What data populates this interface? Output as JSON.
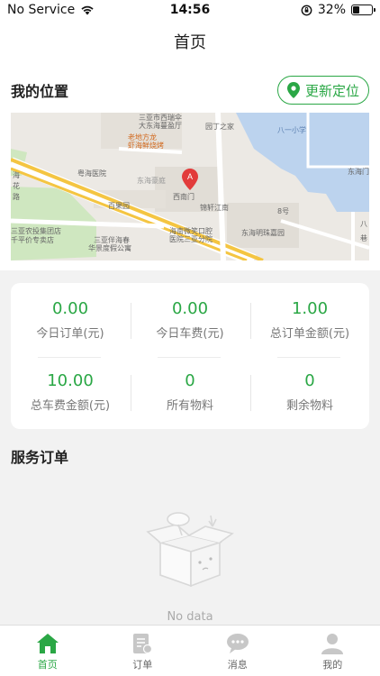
{
  "status_bar": {
    "carrier": "No Service",
    "time": "14:56",
    "battery": "32%"
  },
  "nav": {
    "title": "首页"
  },
  "location": {
    "section_title": "我的位置",
    "update_button": "更新定位"
  },
  "map": {
    "labels": [
      "三亚市西瑞伞",
      "大东海蔓盈厅",
      "老地方龙",
      "虾海鲜烧烤",
      "园丁之家",
      "八一小学",
      "东海门",
      "粤海医院",
      "东海豪庭",
      "西南门",
      "百果园",
      "锦轩江南",
      "海南微笑口腔",
      "医院三亚分院",
      "东海明珠嘉园",
      "三亚农投集团店",
      "三亚伴海春",
      "华景度假公寓",
      "海",
      "花",
      "路",
      "八",
      "巷",
      "千平价专卖店",
      "8号"
    ]
  },
  "stats": [
    {
      "value": "0.00",
      "label": "今日订单(元)"
    },
    {
      "value": "0.00",
      "label": "今日车费(元)"
    },
    {
      "value": "1.00",
      "label": "总订单金额(元)"
    },
    {
      "value": "10.00",
      "label": "总车费金额(元)"
    },
    {
      "value": "0",
      "label": "所有物料"
    },
    {
      "value": "0",
      "label": "剩余物料"
    }
  ],
  "service": {
    "title": "服务订单",
    "empty_text": "No data"
  },
  "tabs": [
    {
      "label": "首页",
      "icon": "home-icon",
      "active": true
    },
    {
      "label": "订单",
      "icon": "order-icon",
      "active": false
    },
    {
      "label": "消息",
      "icon": "message-icon",
      "active": false
    },
    {
      "label": "我的",
      "icon": "profile-icon",
      "active": false
    }
  ],
  "colors": {
    "accent": "#2aa745"
  }
}
